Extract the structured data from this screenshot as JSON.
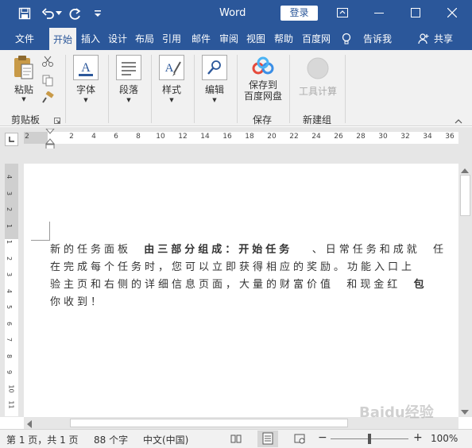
{
  "titlebar": {
    "app_title": "Word",
    "login_label": "登录"
  },
  "tabs": [
    {
      "label": "文件"
    },
    {
      "label": "开始"
    },
    {
      "label": "插入"
    },
    {
      "label": "设计"
    },
    {
      "label": "布局"
    },
    {
      "label": "引用"
    },
    {
      "label": "邮件"
    },
    {
      "label": "审阅"
    },
    {
      "label": "视图"
    },
    {
      "label": "帮助"
    },
    {
      "label": "百度网"
    },
    {
      "label": "告诉我"
    },
    {
      "label": "共享"
    }
  ],
  "ribbon": {
    "paste_label": "粘贴",
    "clipboard_group": "剪贴板",
    "font_label": "字体",
    "paragraph_label": "段落",
    "styles_label": "样式",
    "editing_label": "编辑",
    "save_baidu_line1": "保存到",
    "save_baidu_line2": "百度网盘",
    "save_group": "保存",
    "tool_calc_label": "工具计算",
    "new_group": "新建组"
  },
  "ruler": {
    "h_numbers": [
      "2",
      "2",
      "4",
      "6",
      "8",
      "10",
      "12",
      "14",
      "16",
      "18",
      "20",
      "22",
      "24",
      "26",
      "28",
      "30",
      "32",
      "34",
      "36"
    ],
    "v_numbers": [
      "4",
      "3",
      "2",
      "1",
      "1",
      "2",
      "3",
      "4",
      "5",
      "6",
      "7",
      "8",
      "9",
      "10",
      "11"
    ]
  },
  "document": {
    "line1_a": "新的任务面板",
    "line1_b": "由三部分组成：开始任务",
    "line1_c": "、日常任务和成就",
    "line1_d": "任",
    "line2": "在完成每个任务时，您可以立即获得相应的奖励。功能入口上",
    "line3_a": "验主页和右侧的详细信息页面，大量的财富价值",
    "line3_b": "和现金红",
    "line3_c": "包",
    "line4": "你收到！"
  },
  "status": {
    "page_info": "第 1 页，共 1 页",
    "word_count": "88 个字",
    "language": "中文(中国)",
    "zoom_out": "−",
    "zoom_in": "+",
    "zoom_level": "100%"
  },
  "watermark": "Baidu经验",
  "colors": {
    "accent": "#2b579a",
    "ribbon_bg": "#f1f1f1",
    "canvas_bg": "#e6e6e6"
  }
}
